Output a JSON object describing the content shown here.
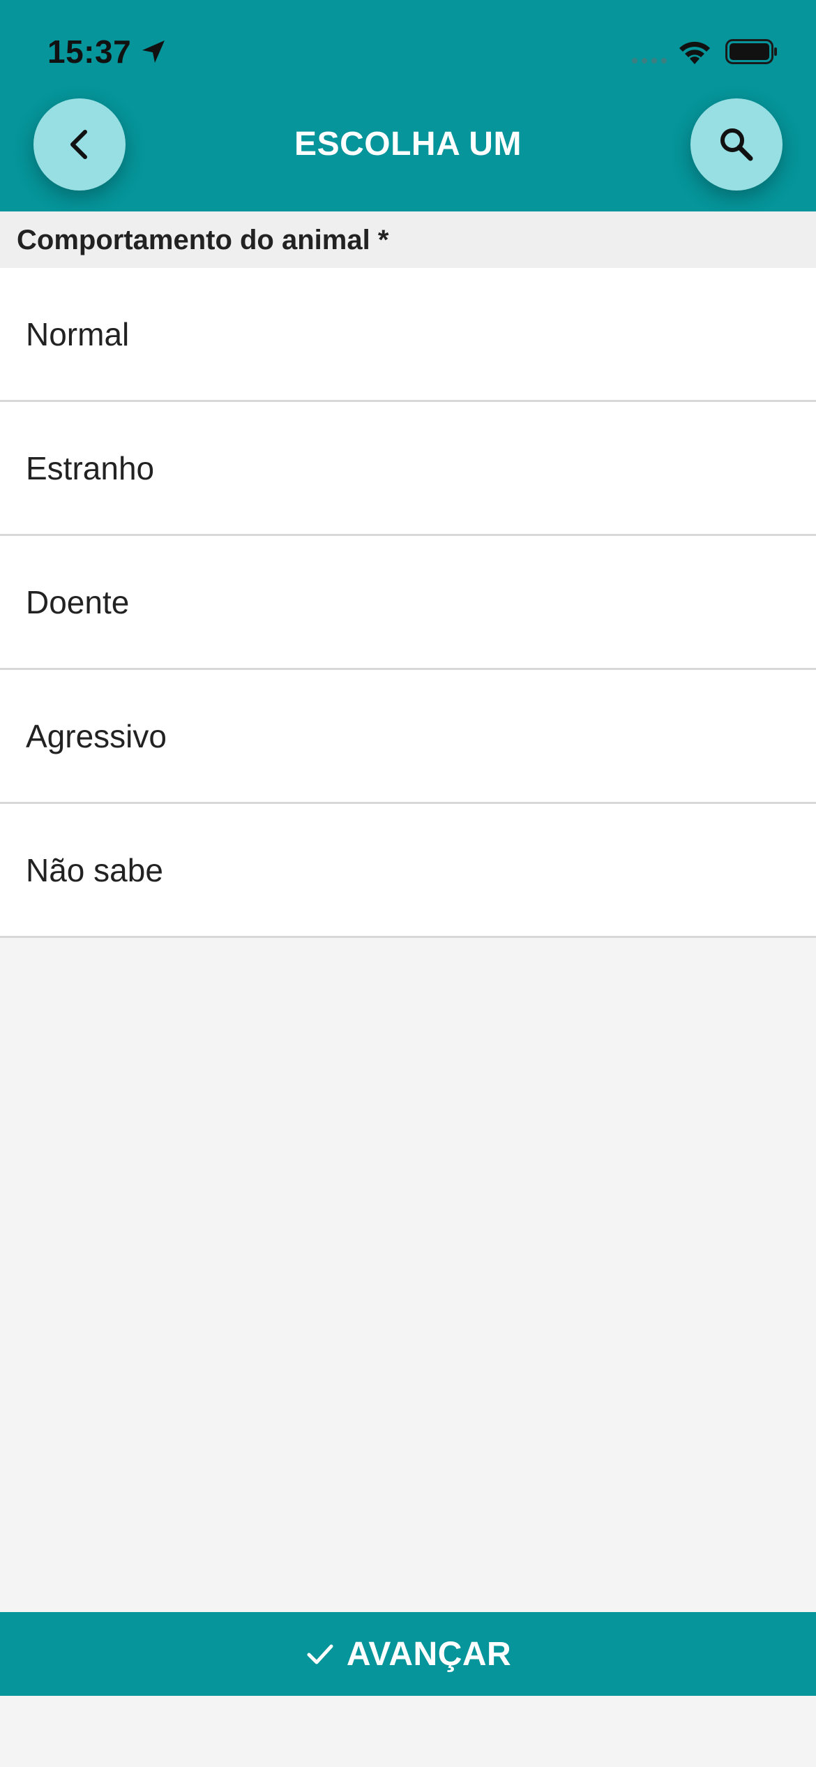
{
  "status_bar": {
    "time": "15:37",
    "icons": [
      "location-arrow-icon",
      "cellular-signal-icon",
      "wifi-icon",
      "battery-icon"
    ]
  },
  "header": {
    "title": "ESCOLHA UM",
    "back_icon": "chevron-left-icon",
    "search_icon": "search-icon",
    "background_color": "#05959a",
    "button_color": "#98dfe3"
  },
  "section": {
    "label": "Comportamento do animal *"
  },
  "options": [
    {
      "label": "Normal"
    },
    {
      "label": "Estranho"
    },
    {
      "label": "Doente"
    },
    {
      "label": "Agressivo"
    },
    {
      "label": "Não sabe"
    }
  ],
  "footer": {
    "advance_label": "AVANÇAR",
    "icon": "check-icon",
    "background_color": "#05959a"
  }
}
